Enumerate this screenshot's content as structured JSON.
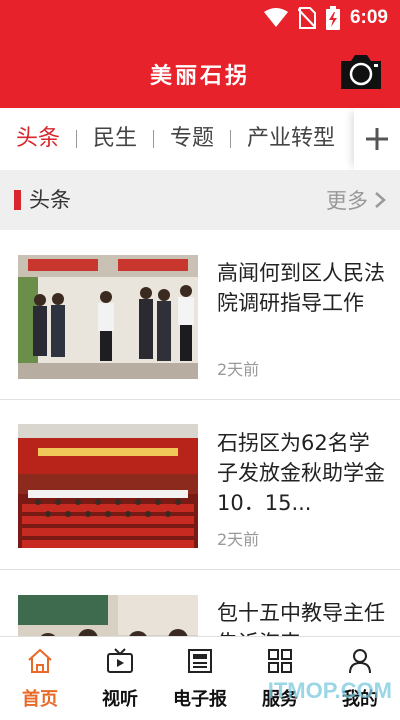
{
  "status_bar": {
    "time": "6:09"
  },
  "header": {
    "title": "美丽石拐"
  },
  "tabs": [
    {
      "label": "头条"
    },
    {
      "label": "民生"
    },
    {
      "label": "专题"
    },
    {
      "label": "产业转型"
    }
  ],
  "section": {
    "title": "头条",
    "more_label": "更多"
  },
  "news": [
    {
      "title": "高闻何到区人民法院调研指导工作",
      "time": "2天前"
    },
    {
      "title": "石拐区为62名学子发放金秋助学金10．15...",
      "time": "2天前"
    },
    {
      "title": "包十五中教导主任告诉海韦",
      "time": ""
    }
  ],
  "bottom_nav": [
    {
      "label": "首页",
      "icon": "home-icon"
    },
    {
      "label": "视听",
      "icon": "tv-icon"
    },
    {
      "label": "电子报",
      "icon": "newspaper-icon"
    },
    {
      "label": "服务",
      "icon": "grid-icon"
    },
    {
      "label": "我的",
      "icon": "person-icon"
    }
  ],
  "watermark": "ITMOP.COM",
  "colors": {
    "brand_red": "#e8222a",
    "active_tab": "#d9262c",
    "active_nav": "#e86a28"
  }
}
